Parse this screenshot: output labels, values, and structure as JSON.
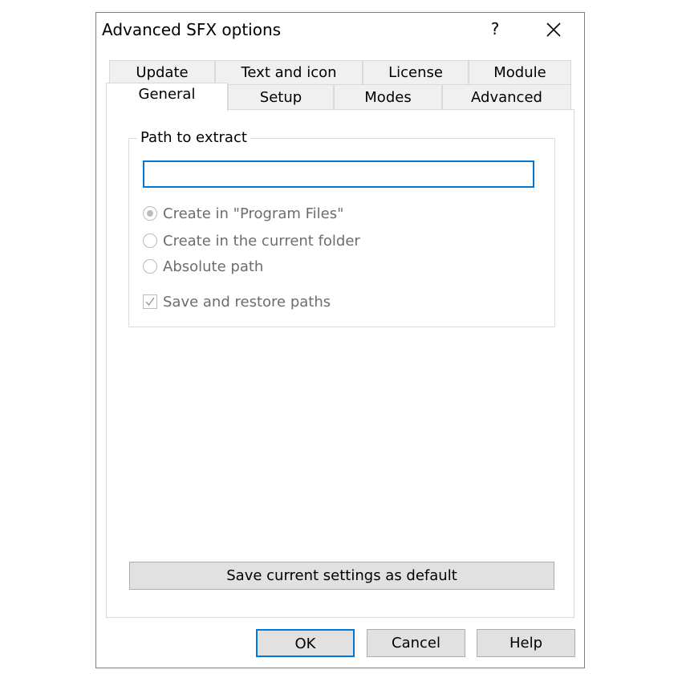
{
  "window": {
    "title": "Advanced SFX options",
    "help_glyph": "?"
  },
  "tabs": {
    "row1": [
      "Update",
      "Text and icon",
      "License",
      "Module"
    ],
    "row2": [
      "General",
      "Setup",
      "Modes",
      "Advanced"
    ],
    "active": "General"
  },
  "path_group": {
    "legend": "Path to extract",
    "input_value": "",
    "options": [
      {
        "label": "Create in \"Program Files\"",
        "checked": true,
        "enabled": false
      },
      {
        "label": "Create in the current folder",
        "checked": false,
        "enabled": false
      },
      {
        "label": "Absolute path",
        "checked": false,
        "enabled": false
      }
    ],
    "save_restore": {
      "label": "Save and restore paths",
      "checked": true,
      "enabled": false
    }
  },
  "buttons": {
    "save_default": "Save current settings as default",
    "ok": "OK",
    "cancel": "Cancel",
    "help": "Help"
  },
  "colors": {
    "accent": "#0078d7",
    "disabled_text": "#6d6d6d",
    "button_bg": "#e1e1e1"
  }
}
